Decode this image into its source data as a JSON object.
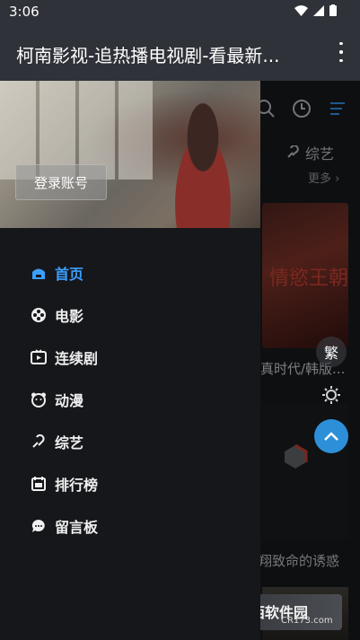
{
  "status_bar": {
    "time": "3:06"
  },
  "app_bar": {
    "title": "柯南影视-追热播电视剧-看最新..."
  },
  "background": {
    "tab_variety": "综艺",
    "more_link": "更多 ›",
    "poster1_text": "情慾王朝",
    "card1_title": "真时代/韩版...",
    "card2_title": "翔致命的诱惑",
    "traditional_toggle": "繁"
  },
  "drawer": {
    "login_button": "登录账号",
    "menu": [
      {
        "label": "首页",
        "icon": "home-icon",
        "active": true
      },
      {
        "label": "电影",
        "icon": "film-reel-icon",
        "active": false
      },
      {
        "label": "连续剧",
        "icon": "tv-icon",
        "active": false
      },
      {
        "label": "动漫",
        "icon": "bear-icon",
        "active": false
      },
      {
        "label": "综艺",
        "icon": "variety-icon",
        "active": false
      },
      {
        "label": "排行榜",
        "icon": "calendar-rank-icon",
        "active": false
      },
      {
        "label": "留言板",
        "icon": "chat-bubble-icon",
        "active": false
      }
    ]
  },
  "watermark": {
    "brand": "西西软件园",
    "sub": "CR173.com"
  },
  "colors": {
    "accent": "#3aa0ff",
    "app_bar": "#2f3238",
    "drawer_bg": "#16171b",
    "float_button": "#2d8fd8"
  }
}
